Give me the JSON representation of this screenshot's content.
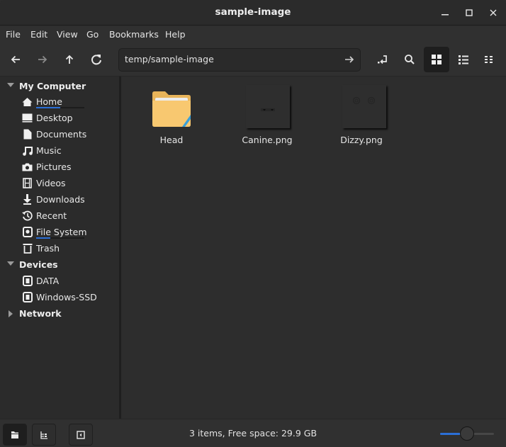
{
  "window": {
    "title": "sample-image"
  },
  "menu": [
    "File",
    "Edit",
    "View",
    "Go",
    "Bookmarks",
    "Help"
  ],
  "location": {
    "path": "temp/sample-image"
  },
  "toolbar": {
    "back": "back-icon",
    "forward": "forward-icon",
    "up": "up-icon",
    "reload": "reload-icon",
    "toggle_location": "toggle-location-icon",
    "search": "search-icon",
    "icon_view": "icon-view-icon",
    "list_view": "list-view-icon",
    "compact_view": "compact-view-icon"
  },
  "sidebar": {
    "sections": [
      {
        "label": "My Computer",
        "expanded": true,
        "items": [
          {
            "label": "Home",
            "icon": "home-icon",
            "usage": 0.5
          },
          {
            "label": "Desktop",
            "icon": "desktop-icon"
          },
          {
            "label": "Documents",
            "icon": "documents-icon"
          },
          {
            "label": "Music",
            "icon": "music-icon"
          },
          {
            "label": "Pictures",
            "icon": "pictures-icon"
          },
          {
            "label": "Videos",
            "icon": "videos-icon"
          },
          {
            "label": "Downloads",
            "icon": "downloads-icon"
          },
          {
            "label": "Recent",
            "icon": "recent-icon"
          },
          {
            "label": "File System",
            "icon": "filesystem-icon",
            "usage": 0.3
          },
          {
            "label": "Trash",
            "icon": "trash-icon"
          }
        ]
      },
      {
        "label": "Devices",
        "expanded": true,
        "items": [
          {
            "label": "DATA",
            "icon": "drive-icon"
          },
          {
            "label": "Windows-SSD",
            "icon": "drive-icon"
          }
        ]
      },
      {
        "label": "Network",
        "expanded": false,
        "items": []
      }
    ]
  },
  "files": [
    {
      "name": "Head",
      "type": "folder"
    },
    {
      "name": "Canine.png",
      "type": "image"
    },
    {
      "name": "Dizzy.png",
      "type": "image"
    }
  ],
  "status": {
    "text": "3 items, Free space: 29.9 GB",
    "zoom_level": 0.5
  },
  "colors": {
    "accent": "#2b6fd6",
    "folder": "#f8c870",
    "folder_stripe": "#3a9fd8"
  }
}
